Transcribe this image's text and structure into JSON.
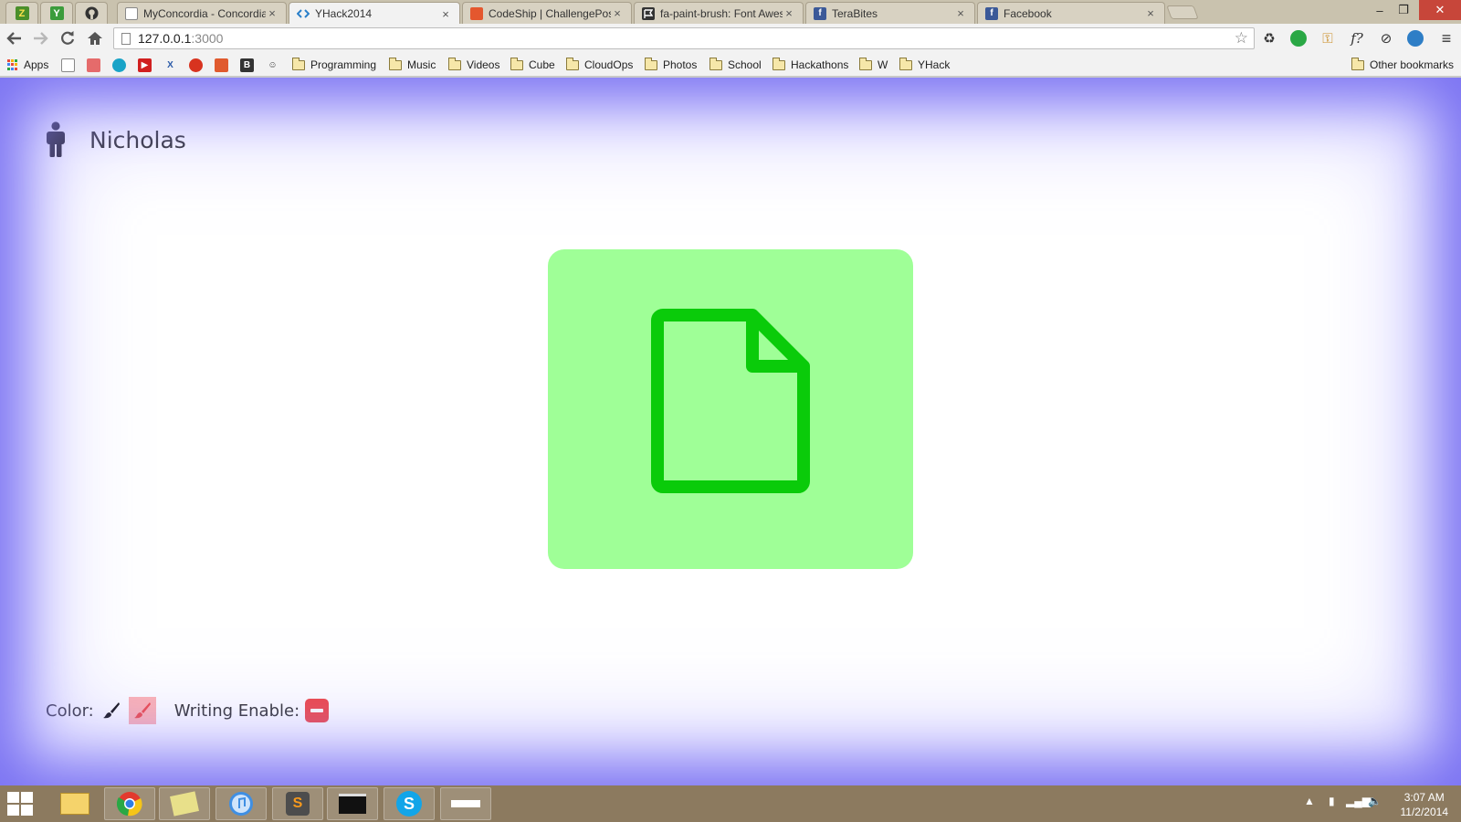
{
  "browser": {
    "pinned_tabs": [
      {
        "icon": "zotero-icon",
        "letter": "Z",
        "color": "#4a8f2b"
      },
      {
        "icon": "ycombinator-icon",
        "letter": "Y",
        "color": "#3c9c3c"
      },
      {
        "icon": "github-icon",
        "letter": "",
        "color": "#333333"
      }
    ],
    "tabs": [
      {
        "title": "MyConcordia - Concordia",
        "icon": "page-icon",
        "active": false
      },
      {
        "title": "YHack2014",
        "icon": "code-icon",
        "active": true
      },
      {
        "title": "CodeShip | ChallengePost",
        "icon": "challengepost-icon",
        "active": false
      },
      {
        "title": "fa-paint-brush: Font Awesome",
        "icon": "flag-icon",
        "active": false
      },
      {
        "title": "TeraBites",
        "icon": "facebook-icon",
        "active": false
      },
      {
        "title": "Facebook",
        "icon": "facebook-icon",
        "active": false
      }
    ],
    "tab_close_glyph": "×",
    "window_controls": {
      "minimize": "–",
      "restore": "❐",
      "close": "✕"
    },
    "url_host": "127.0.0.1",
    "url_port": ":3000",
    "bookmarks": {
      "apps_label": "Apps",
      "folders": [
        "Programming",
        "Music",
        "Videos",
        "Cube",
        "CloudOps",
        "Photos",
        "School",
        "Hackathons",
        "W",
        "YHack"
      ],
      "other": "Other bookmarks"
    }
  },
  "app": {
    "user_name": "Nicholas",
    "color_label": "Color:",
    "writing_label": "Writing Enable:",
    "card_color": "#9fff97",
    "doc_icon_color": "#0acb0a",
    "selected_color": "#ffb3b3",
    "toggle_color": "#f04848"
  },
  "taskbar": {
    "time": "3:07 AM",
    "date": "11/2/2014"
  }
}
